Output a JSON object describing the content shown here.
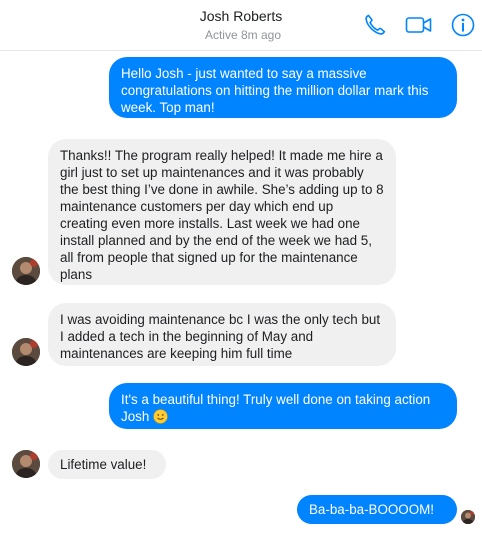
{
  "header": {
    "name": "Josh Roberts",
    "status": "Active 8m ago",
    "accent_color": "#0084ff",
    "icons": [
      "phone-icon",
      "video-camera-icon",
      "info-icon"
    ]
  },
  "messages": [
    {
      "from": "me",
      "text": "Hello Josh - just wanted to say a massive congratulations on hitting the million dollar mark this week.  Top man!"
    },
    {
      "from": "josh",
      "text": "Thanks!! The program really helped! It made me hire a girl just to set up maintenances and it was probably the best thing I’ve done in awhile. She’s adding up to 8 maintenance customers per day which end up creating even more installs. Last week we had one install planned and by the end of the week we had 5, all from people that signed up for the maintenance plans"
    },
    {
      "from": "josh",
      "text": "I was avoiding maintenance bc I was the only tech but I added a tech in the beginning of May and maintenances are keeping him full time"
    },
    {
      "from": "me",
      "text": "It's a beautiful thing!  Truly well done on taking action Josh",
      "emoji": "slightly-smiling-face-icon"
    },
    {
      "from": "josh",
      "text": "Lifetime value!"
    },
    {
      "from": "me",
      "text": "Ba-ba-ba-BOOOOM!"
    }
  ],
  "colors": {
    "outgoing_bubble": "#0084ff",
    "incoming_bubble": "#f1f0f0"
  }
}
